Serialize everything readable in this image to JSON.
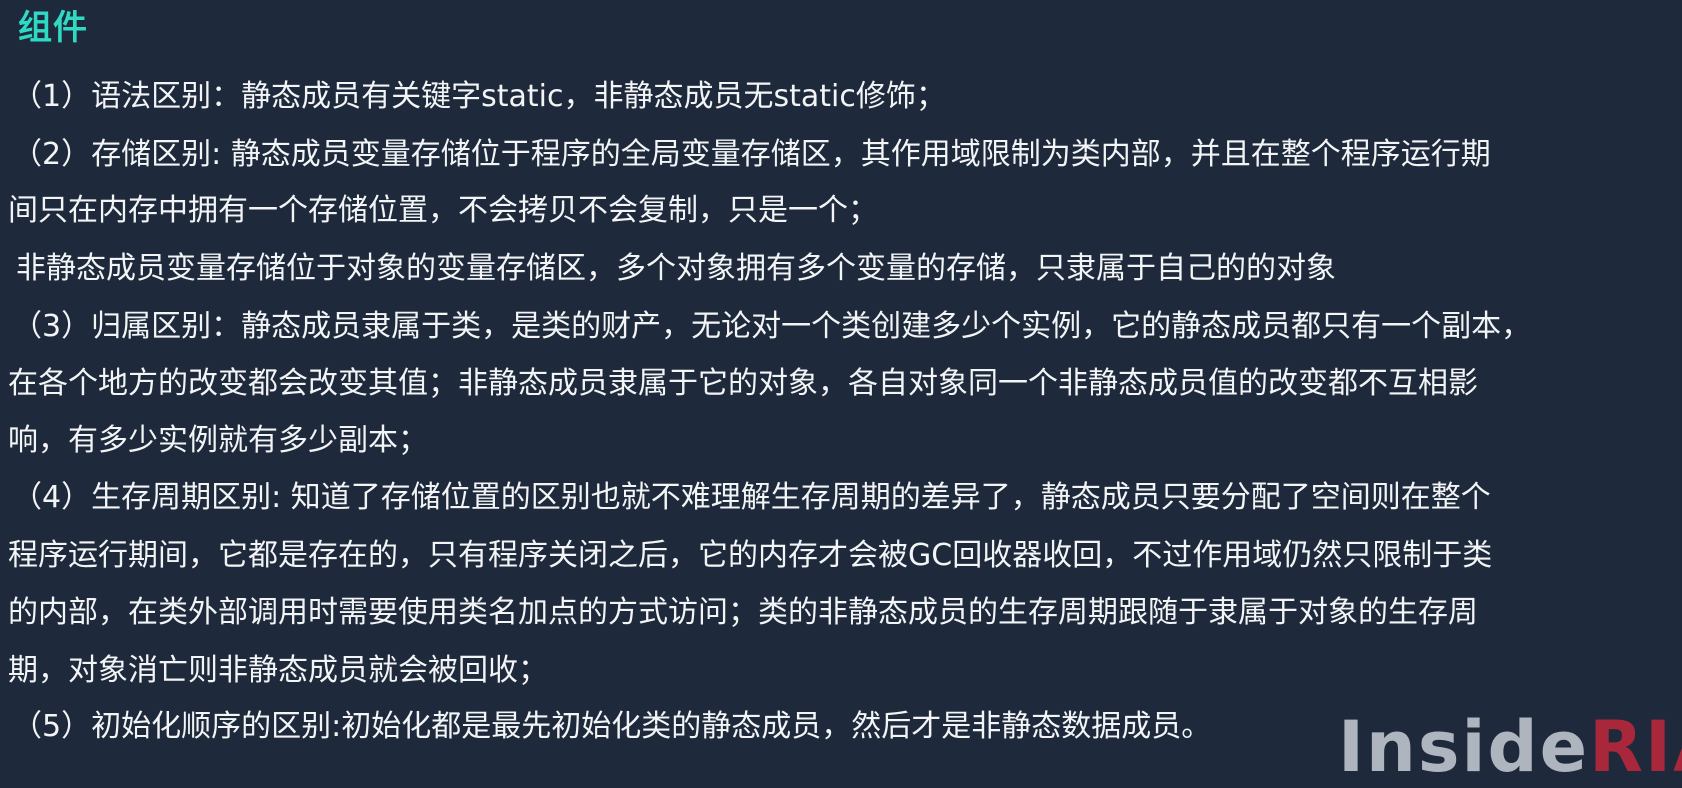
{
  "title": "组件",
  "lines": [
    "（1）语法区别：静态成员有关键字static，非静态成员无static修饰；",
    "（2）存储区别: 静态成员变量存储位于程序的全局变量存储区，其作用域限制为类内部，并且在整个程序运行期",
    "间只在内存中拥有一个存储位置，不会拷贝不会复制，只是一个；",
    "非静态成员变量存储位于对象的变量存储区，多个对象拥有多个变量的存储，只隶属于自己的的对象",
    "（3）归属区别：静态成员隶属于类，是类的财产，无论对一个类创建多少个实例，它的静态成员都只有一个副本，",
    "在各个地方的改变都会改变其值；非静态成员隶属于它的对象，各自对象同一个非静态成员值的改变都不互相影",
    "响，有多少实例就有多少副本；",
    "（4）生存周期区别: 知道了存储位置的区别也就不难理解生存周期的差异了，静态成员只要分配了空间则在整个",
    "程序运行期间，它都是存在的，只有程序关闭之后，它的内存才会被GC回收器收回，不过作用域仍然只限制于类",
    "的内部，在类外部调用时需要使用类名加点的方式访问；类的非静态成员的生存周期跟随于隶属于对象的生存周",
    "期，对象消亡则非静态成员就会被回收；",
    "（5）初始化顺序的区别:初始化都是最先初始化类的静态成员，然后才是非静态数据成员。"
  ],
  "watermark": {
    "part1": "Inside",
    "part2": "RIA"
  },
  "colors": {
    "background": "#1e2a3b",
    "title": "#2fd9c4",
    "text": "#f2f4f6",
    "watermark_accent": "#c2273a"
  }
}
